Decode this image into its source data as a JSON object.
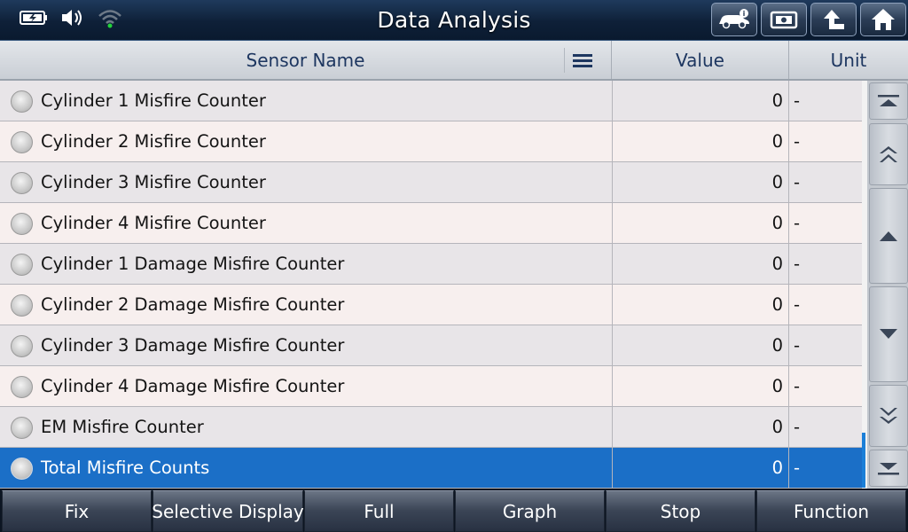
{
  "header": {
    "title": "Data Analysis",
    "status_icons": [
      "battery-icon",
      "speaker-icon",
      "wifi-icon"
    ],
    "tool_buttons": [
      "vehicle-info-icon",
      "screenshot-icon",
      "back-arrow-icon",
      "home-icon"
    ]
  },
  "table": {
    "columns": {
      "name": "Sensor Name",
      "value": "Value",
      "unit": "Unit"
    },
    "rows": [
      {
        "name": "Cylinder 1 Misfire Counter",
        "value": "0",
        "unit": "-"
      },
      {
        "name": "Cylinder 2 Misfire Counter",
        "value": "0",
        "unit": "-"
      },
      {
        "name": "Cylinder 3 Misfire Counter",
        "value": "0",
        "unit": "-"
      },
      {
        "name": "Cylinder 4 Misfire Counter",
        "value": "0",
        "unit": "-"
      },
      {
        "name": "Cylinder 1 Damage Misfire Counter",
        "value": "0",
        "unit": "-"
      },
      {
        "name": "Cylinder 2 Damage Misfire Counter",
        "value": "0",
        "unit": "-"
      },
      {
        "name": "Cylinder 3 Damage Misfire Counter",
        "value": "0",
        "unit": "-"
      },
      {
        "name": "Cylinder 4 Damage Misfire Counter",
        "value": "0",
        "unit": "-"
      },
      {
        "name": "EM Misfire Counter",
        "value": "0",
        "unit": "-"
      },
      {
        "name": "Total Misfire Counts",
        "value": "0",
        "unit": "-"
      }
    ],
    "selected_row": "Total Misfire Counts"
  },
  "side_nav": [
    "scroll-top-icon",
    "page-up-icon",
    "line-up-icon",
    "line-down-icon",
    "page-down-icon",
    "scroll-bottom-icon"
  ],
  "toolbar": {
    "fix": "Fix",
    "selective_display": "Selective Display",
    "full": "Full",
    "graph": "Graph",
    "stop": "Stop",
    "function": "Function"
  },
  "colors": {
    "selected_row": "#1b6fc7",
    "header_text": "#1d3660",
    "title_bar": "#0e2038"
  }
}
